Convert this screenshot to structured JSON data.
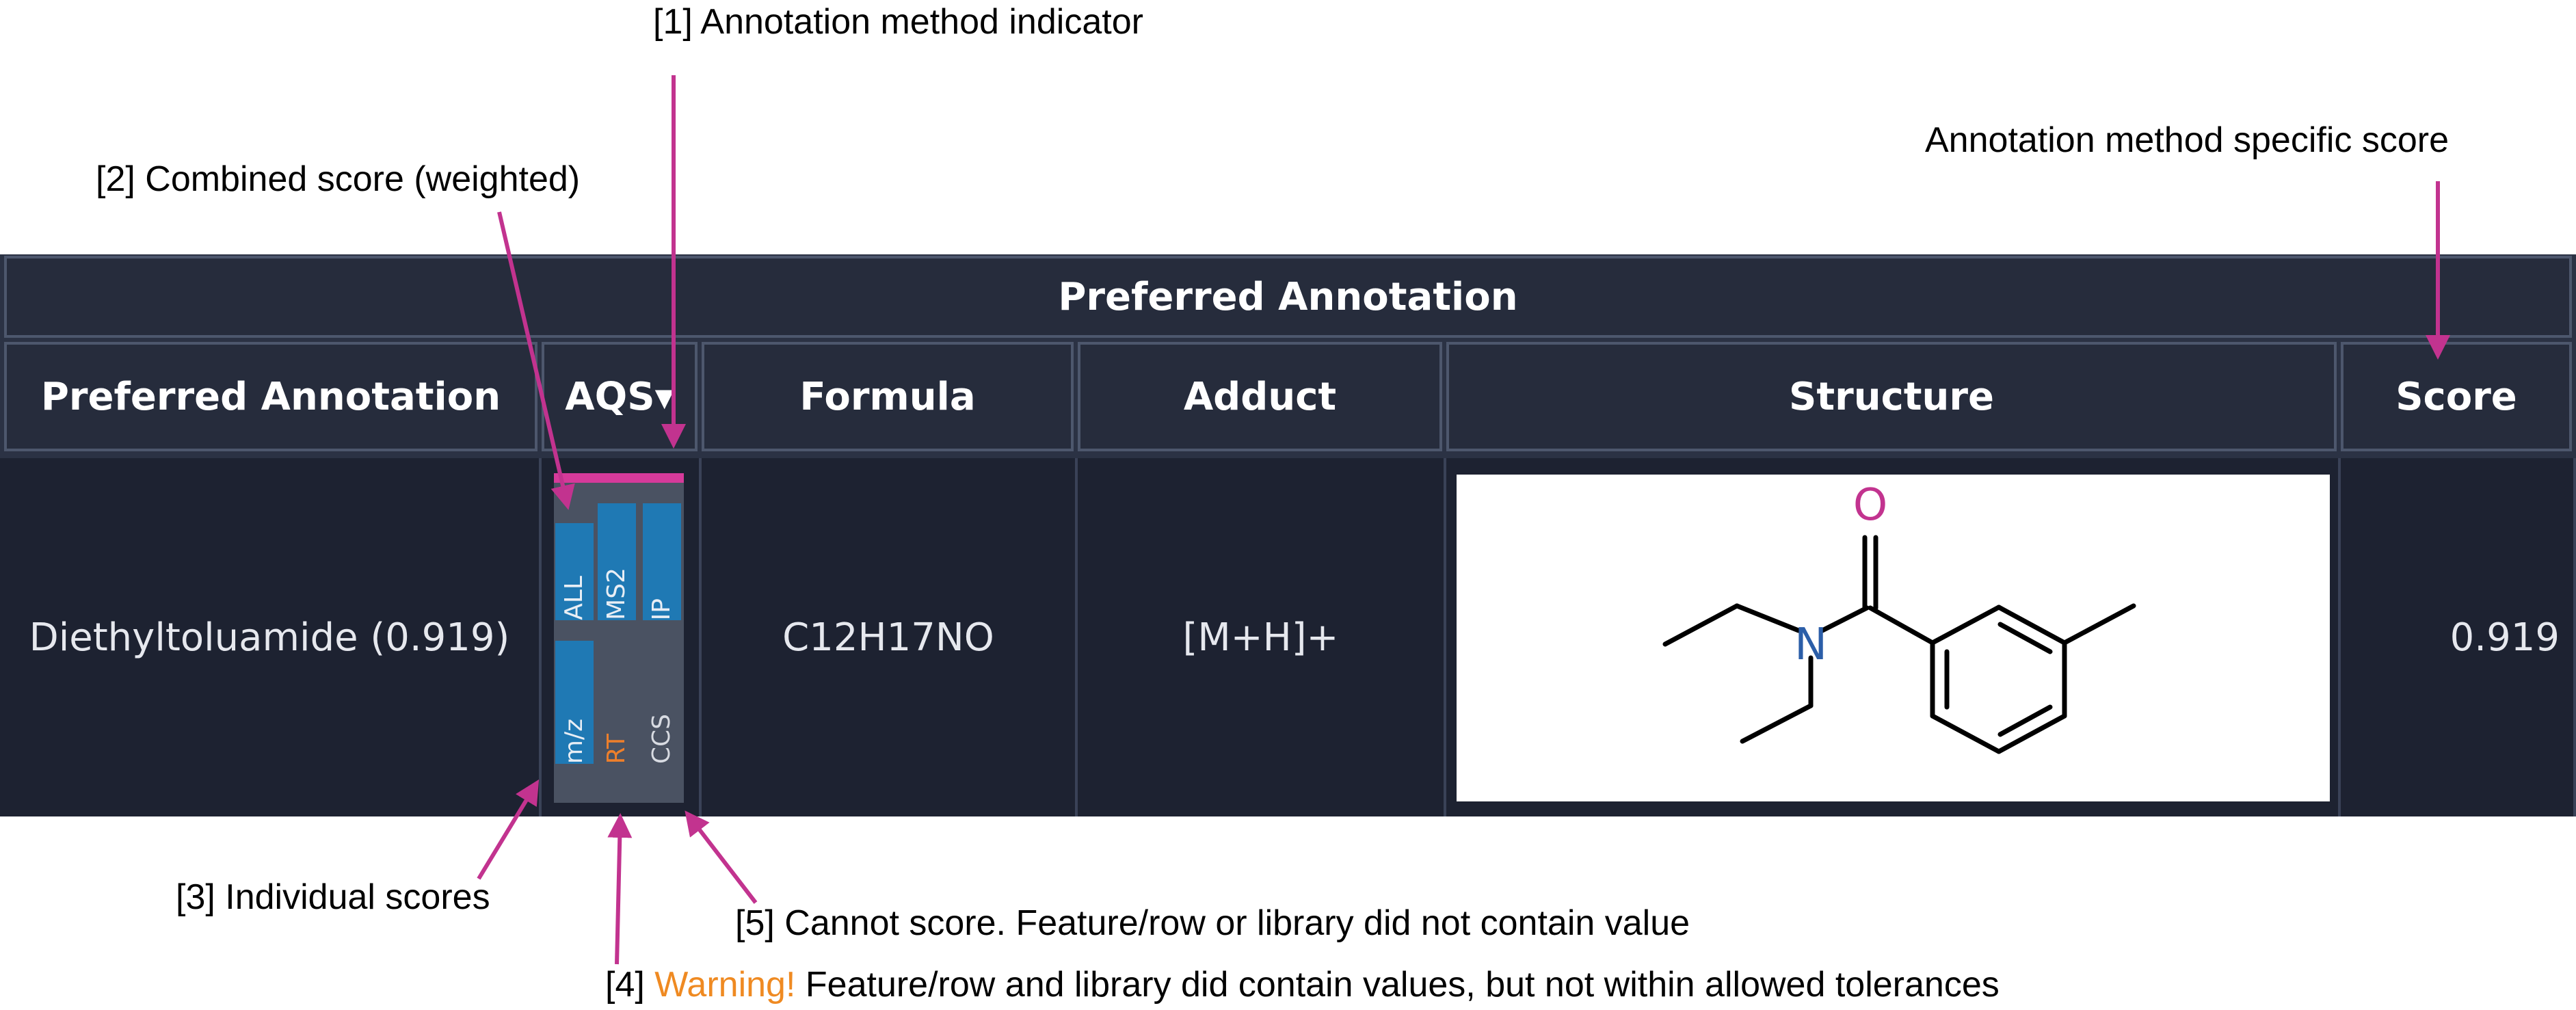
{
  "annotations": {
    "method_indicator": "[1] Annotation method indicator",
    "combined_score": "[2] Combined score (weighted)",
    "individual_scores": "[3] Individual scores",
    "warning_prefix": "[4]",
    "warning_word": "Warning!",
    "warning_text": "Feature/row and library did contain values, but not within allowed tolerances",
    "cannot_score": "[5] Cannot score. Feature/row or library did not contain value",
    "method_specific_score": "Annotation method specific score"
  },
  "table": {
    "group_header": "Preferred Annotation",
    "columns": {
      "preferred_annotation": "Preferred Annotation",
      "aqs": "AQS▾",
      "formula": "Formula",
      "adduct": "Adduct",
      "structure": "Structure",
      "score": "Score"
    },
    "row": {
      "preferred_annotation": "Diethyltoluamide (0.919)",
      "formula": "C12H17NO",
      "adduct": "[M+H]+",
      "score": "0.919",
      "aqs_tiles": [
        {
          "label": "ALL",
          "state": "scored",
          "fill": 0.75
        },
        {
          "label": "MS2",
          "state": "scored",
          "fill": 0.9
        },
        {
          "label": "IP",
          "state": "scored",
          "fill": 0.9
        },
        {
          "label": "m/z",
          "state": "scored",
          "fill": 0.9
        },
        {
          "label": "RT",
          "state": "warning"
        },
        {
          "label": "CCS",
          "state": "not-scored"
        }
      ],
      "structure_atoms": {
        "oxygen": "O",
        "nitrogen": "N"
      }
    }
  },
  "colors": {
    "annotation_arrow": "#c2338f",
    "header_bg": "#262c3c",
    "cell_bg": "#1d2231",
    "score_fill": "#1f79b4",
    "warning": "#ef8a22",
    "oxygen": "#c2338f",
    "nitrogen": "#2b5ea8"
  }
}
